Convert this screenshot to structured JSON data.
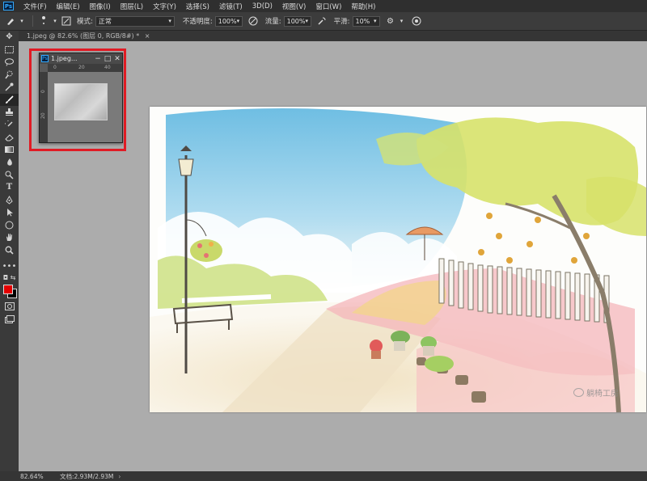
{
  "app": {
    "logo": "Ps"
  },
  "menu": [
    "文件(F)",
    "编辑(E)",
    "图像(I)",
    "图层(L)",
    "文字(Y)",
    "选择(S)",
    "滤镜(T)",
    "3D(D)",
    "视图(V)",
    "窗口(W)",
    "帮助(H)"
  ],
  "options": {
    "mode_label": "模式:",
    "mode_value": "正常",
    "opacity_label": "不透明度:",
    "opacity_value": "100%",
    "flow_label": "流量:",
    "flow_value": "100%",
    "smoothing_label": "平滑:",
    "smoothing_value": "10%"
  },
  "document_tab": {
    "label": "1.jpeg @ 82.6% (图层 0, RGB/8#) *",
    "close": "×"
  },
  "float_window": {
    "title": "1.jpeg...",
    "ruler_h": [
      "0",
      "20",
      "40"
    ],
    "ruler_v": [
      "0",
      "20"
    ]
  },
  "watermark": {
    "text": "躺椅工房"
  },
  "colors": {
    "foreground": "#e30000",
    "background": "#000000",
    "highlight": "#e01b24"
  },
  "status": {
    "zoom": "82.64%",
    "doc_info": "文档:2.93M/2.93M"
  },
  "tools": [
    "move-icon",
    "marquee-icon",
    "lasso-icon",
    "quick-select-icon",
    "eyedropper-icon",
    "brush-icon",
    "stamp-icon",
    "history-brush-icon",
    "eraser-icon",
    "gradient-icon",
    "blur-icon",
    "dodge-icon",
    "type-icon",
    "pen-icon",
    "path-select-icon",
    "shape-icon",
    "hand-icon",
    "zoom-icon",
    "more-icon"
  ]
}
